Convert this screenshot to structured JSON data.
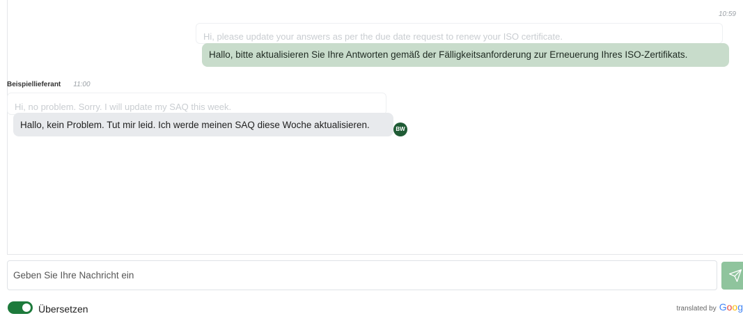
{
  "conversation": {
    "outgoing": {
      "timestamp": "10:59",
      "original_text": "Hi, please update your answers as per the due date request to renew your ISO certificate.",
      "translated_text": "Hallo, bitte aktualisieren Sie Ihre Antworten gemäß der Fälligkeitsanforderung zur Erneuerung Ihres ISO-Zertifikats."
    },
    "incoming": {
      "sender": "Beispiellieferant",
      "timestamp": "11:00",
      "original_text": "Hi, no problem. Sorry. I will update my SAQ this week.",
      "translated_text": "Hallo, kein Problem. Tut mir leid. Ich werde meinen SAQ diese Woche aktualisieren.",
      "avatar_initials": "BW"
    }
  },
  "composer": {
    "placeholder": "Geben Sie Ihre Nachricht ein",
    "value": "",
    "send_icon": "send-icon"
  },
  "translate_toggle": {
    "label": "Übersetzen",
    "enabled": true
  },
  "attribution": {
    "prefix": "translated by",
    "brand": "Goog",
    "brand_colors": [
      "#4285F4",
      "#EA4335",
      "#FBBC05",
      "#4285F4"
    ]
  },
  "colors": {
    "outgoing_bubble": "#c8dccb",
    "incoming_bubble": "#e8eaed",
    "avatar": "#1f5b35",
    "toggle_on": "#1d7a3b",
    "send_button": "#8fc49d"
  }
}
